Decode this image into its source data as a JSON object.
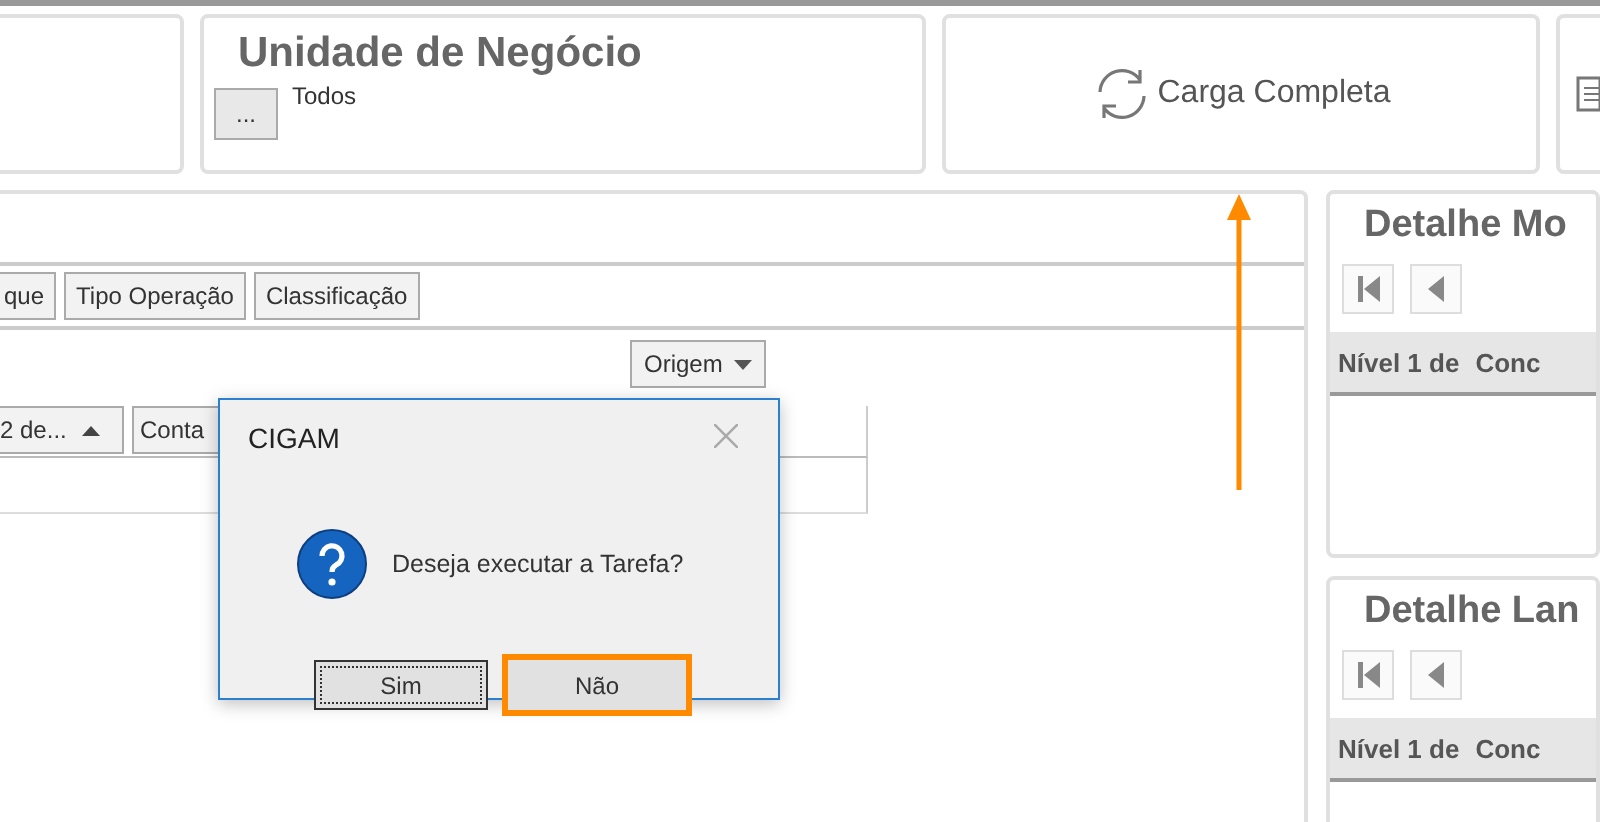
{
  "top_cards": [
    {
      "kind": "blank"
    },
    {
      "kind": "filter",
      "title": "Unidade de Negócio",
      "button": "...",
      "value": "Todos"
    },
    {
      "kind": "action",
      "label": "Carga Completa"
    },
    {
      "kind": "report"
    }
  ],
  "group_by": [
    "que",
    "Tipo Operação",
    "Classificação"
  ],
  "filter_button": {
    "label": "Origem"
  },
  "columns": [
    {
      "label": "2 de...",
      "sorted_ascending": true
    },
    {
      "label": "Conta"
    }
  ],
  "detail_panels": [
    {
      "title": "Detalhe Mo",
      "columns": [
        "Nível 1 de",
        "Conc"
      ]
    },
    {
      "title": "Detalhe Lan",
      "columns": [
        "Nível 1 de",
        "Conc"
      ]
    }
  ],
  "dialog": {
    "title": "CIGAM",
    "message": "Deseja executar a Tarefa?",
    "buttons": [
      {
        "label": "Sim",
        "focused": true,
        "highlighted": false
      },
      {
        "label": "Não",
        "focused": false,
        "highlighted": true
      }
    ]
  }
}
